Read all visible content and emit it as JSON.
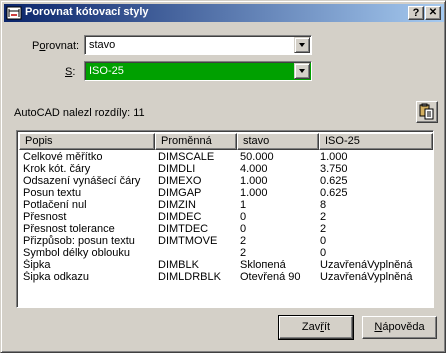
{
  "window": {
    "title": "Porovnat kótovací styly",
    "help_glyph": "?",
    "close_glyph": "✕"
  },
  "compare": {
    "label_prefix": "P",
    "label_underlined": "o",
    "label_suffix": "rovnat:",
    "value": "stavo"
  },
  "with": {
    "label_underlined": "S",
    "label_suffix": ":",
    "value": "ISO-25",
    "highlight_color": "#00a000"
  },
  "status": {
    "text": "AutoCAD nalezl rozdíly: 11"
  },
  "table": {
    "headers": [
      "Popis",
      "Proměnná",
      "stavo",
      "ISO-25"
    ],
    "rows": [
      [
        "Celkové měřítko",
        "DIMSCALE",
        "50.000",
        "1.000"
      ],
      [
        "Krok kót. čáry",
        "DIMDLI",
        "4.000",
        "3.750"
      ],
      [
        "Odsazení vynášecí čáry",
        "DIMEXO",
        "1.000",
        "0.625"
      ],
      [
        "Posun textu",
        "DIMGAP",
        "1.000",
        "0.625"
      ],
      [
        "Potlačení nul",
        "DIMZIN",
        "1",
        "8"
      ],
      [
        "Přesnost",
        "DIMDEC",
        "0",
        "2"
      ],
      [
        "Přesnost tolerance",
        "DIMTDEC",
        "0",
        "2"
      ],
      [
        "Přizpůsob: posun textu",
        "DIMTMOVE",
        "2",
        "0"
      ],
      [
        "Symbol délky oblouku",
        "",
        "2",
        "0"
      ],
      [
        "Šipka",
        "DIMBLK",
        "Skloпená",
        "UzavřenáVyplněná"
      ],
      [
        "Šipka odkazu",
        "DIMLDRBLK",
        "Otevřená 90",
        "UzavřenáVyplněná"
      ]
    ]
  },
  "buttons": {
    "close_prefix": "Zav",
    "close_underlined": "ř",
    "close_suffix": "ít",
    "help_prefix": "",
    "help_underlined": "N",
    "help_suffix": "ápověda"
  }
}
